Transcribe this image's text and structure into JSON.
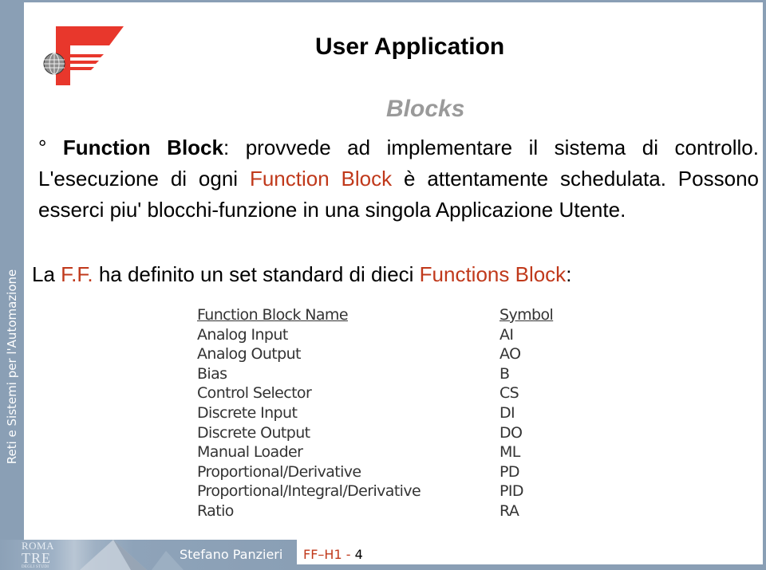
{
  "sidebar": {
    "label": "Reti e Sistemi per l'Automazione"
  },
  "logo": {
    "name": "fieldbus-foundation-logo",
    "brand_color": "#e8372c"
  },
  "header": {
    "title": "User Application",
    "subtitle": "Blocks"
  },
  "body": {
    "bullet": "°",
    "term": "Function Block",
    "colon": ":",
    "text1": " provvede ad implementare il sistema di controllo. L'esecuzione di ogni ",
    "highlight1": "Function Block",
    "text2": " è attentamente schedulata. Possono esserci piu' blocchi-funzione in una singola Applicazione Utente.",
    "intro_prefix": "La ",
    "intro_ff": "F.F.",
    "intro_mid": " ha definito un set standard di dieci ",
    "intro_highlight": "Functions Block",
    "intro_suffix": ":"
  },
  "table": {
    "headers": {
      "name": "Function Block Name",
      "symbol": "Symbol"
    },
    "rows": [
      {
        "name": "Analog Input",
        "symbol": "AI"
      },
      {
        "name": "Analog Output",
        "symbol": "AO"
      },
      {
        "name": "Bias",
        "symbol": "B"
      },
      {
        "name": "Control Selector",
        "symbol": "CS"
      },
      {
        "name": "Discrete Input",
        "symbol": "DI"
      },
      {
        "name": "Discrete Output",
        "symbol": "DO"
      },
      {
        "name": "Manual Loader",
        "symbol": "ML"
      },
      {
        "name": "Proportional/Derivative",
        "symbol": "PD"
      },
      {
        "name": "Proportional/Integral/Derivative",
        "symbol": "PID"
      },
      {
        "name": "Ratio",
        "symbol": "RA"
      }
    ]
  },
  "footer": {
    "university": {
      "line1": "ROMA",
      "line2": "TRE",
      "line3": "DEGLI STUDI"
    },
    "author": "Stefano Panzieri",
    "slide_code": "FF–H1",
    "separator": " - ",
    "page_number": "4"
  },
  "colors": {
    "accent": "#c0391b",
    "frame": "#8a9fb5",
    "subtitle": "#9a9a9a"
  }
}
